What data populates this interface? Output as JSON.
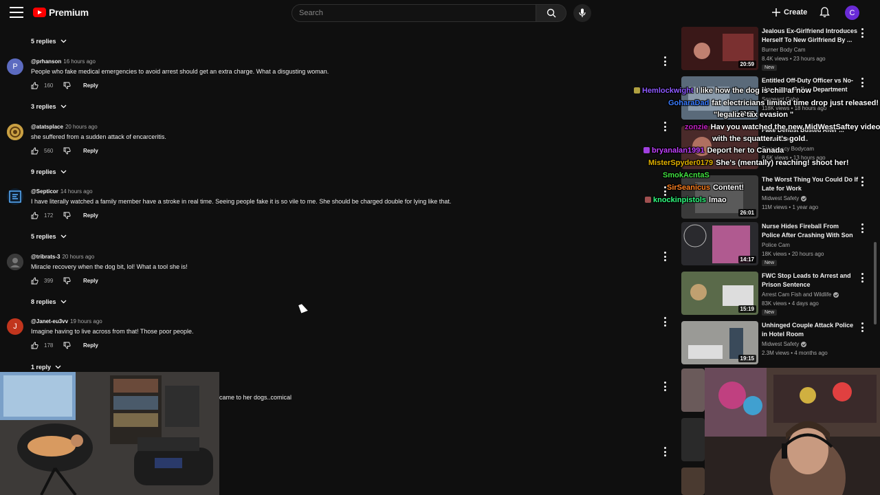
{
  "header": {
    "logo_text": "Premium",
    "search_placeholder": "Search",
    "create_label": "Create",
    "avatar_letter": "C"
  },
  "comments": [
    {
      "replies_label": "5 replies"
    },
    {
      "avatar_letter": "P",
      "avatar_color": "#5c6bc0",
      "handle": "@prhanson",
      "time": "16 hours ago",
      "text": "People who fake medical emergencies to avoid arrest should get an extra charge. What a disgusting woman.",
      "likes": "160",
      "reply_label": "Reply",
      "replies_label": "3 replies"
    },
    {
      "avatar_letter": "",
      "avatar_color": "#b58a2a",
      "handle": "@atatsplace",
      "time": "20 hours ago",
      "text": "she suffered from a sudden attack of encarceritis.",
      "likes": "560",
      "reply_label": "Reply",
      "replies_label": "9 replies"
    },
    {
      "avatar_letter": "",
      "avatar_color": "#1b3a5a",
      "handle": "@Septicor",
      "time": "14 hours ago",
      "text": "I have literally watched a family member have a stroke in real time. Seeing people fake it is so vile to me. She should be charged double for lying like that.",
      "likes": "172",
      "reply_label": "Reply",
      "replies_label": "5 replies"
    },
    {
      "avatar_letter": "",
      "avatar_color": "#444444",
      "handle": "@tribrats-3",
      "time": "20 hours ago",
      "text": "Miracle recovery when the dog bit, lol! What a tool she is!",
      "likes": "399",
      "reply_label": "Reply",
      "replies_label": "8 replies"
    },
    {
      "avatar_letter": "J",
      "avatar_color": "#c1351d",
      "handle": "@Janet-eu3vv",
      "time": "19 hours ago",
      "text": "Imagine having to live across from that! Those poor people.",
      "likes": "178",
      "reply_label": "Reply",
      "replies_label": "1 reply"
    }
  ],
  "partial_comment_text": "came to her dogs..comical",
  "videos": [
    {
      "title": "Jealous Ex-Girlfriend Introduces Herself To New Girlfriend By ...",
      "channel": "Burner Body Cam",
      "verified": false,
      "stats": "8.4K views • 23 hours ago",
      "duration": "20:59",
      "new_badge": "New",
      "thumb_color": "#7a2a2a"
    },
    {
      "title": "Entitled Off-Duty Officer vs No-Nonsense Police Department",
      "channel": "Sergeant Gabe",
      "verified": false,
      "stats": "118K views • 18 hours ago",
      "duration": "22:37",
      "new_badge": "",
      "thumb_color": "#6a7a8a"
    },
    {
      "title": "Fake Dentist Busted After ... Canal Comes ...",
      "channel": "Emergency Bodycam",
      "verified": false,
      "stats": "8.6K views • 13 hours ago",
      "duration": "",
      "new_badge": "",
      "thumb_color": "#5a3a3a"
    },
    {
      "title": "The Worst Thing You Could Do If Late for Work",
      "channel": "Midwest Safety",
      "verified": true,
      "stats": "11M views • 1 year ago",
      "duration": "26:01",
      "new_badge": "",
      "thumb_color": "#4a4a4a"
    },
    {
      "title": "Nurse Hides Fireball From Police After Crashing With Son",
      "channel": "Police Cam",
      "verified": false,
      "stats": "18K views • 20 hours ago",
      "duration": "14:17",
      "new_badge": "New",
      "thumb_color": "#a05a8a"
    },
    {
      "title": "FWC Stop Leads to Arrest and Prison Sentence",
      "channel": "Arrest Cam Fish and Wildlife",
      "verified": true,
      "stats": "83K views • 4 days ago",
      "duration": "15:19",
      "new_badge": "New",
      "thumb_color": "#5a6a4a"
    },
    {
      "title": "Unhinged Couple Attack Police in Hotel Room",
      "channel": "Midwest Safety",
      "verified": true,
      "stats": "2.3M views • 4 months ago",
      "duration": "19:15",
      "new_badge": "",
      "thumb_color": "#8a8a88"
    }
  ],
  "chat": [
    {
      "user": "Hemlockwight",
      "user_color": "#8e5aff",
      "message": "I like how the dog is chill af now",
      "badge_color": "#b0a040"
    },
    {
      "user": "GoharaDad",
      "user_color": "#3a7cff",
      "message": "fat electricians limited time drop just released!",
      "badge_color": ""
    },
    {
      "user": "",
      "user_color": "#ffffff",
      "message": "\"legalize tax evasion \"",
      "badge_color": ""
    },
    {
      "user": "zonzie",
      "user_color": "#c020c0",
      "message": "Hav you watched the new MidWestSaftey video",
      "badge_color": ""
    },
    {
      "user": "",
      "user_color": "#ffffff",
      "message": "with the squatter. it's gold",
      "badge_color": ""
    },
    {
      "user": "bryanalan1991",
      "user_color": "#c040ff",
      "message": "Deport her to Canada",
      "badge_color": "#a040e0"
    },
    {
      "user": "MisterSpyder0179",
      "user_color": "#e0b000",
      "message": "She's (mentally) reaching! shoot her!",
      "badge_color": ""
    },
    {
      "user": "SmokAcntaS",
      "user_color": "#40e040",
      "message": "",
      "badge_color": ""
    },
    {
      "user": "SirSeanicus",
      "user_color": "#ff8020",
      "message": "Content!",
      "badge_color": ""
    },
    {
      "user": "knockinpistols",
      "user_color": "#30ff80",
      "message": "lmao",
      "badge_color": "#a05050"
    }
  ]
}
